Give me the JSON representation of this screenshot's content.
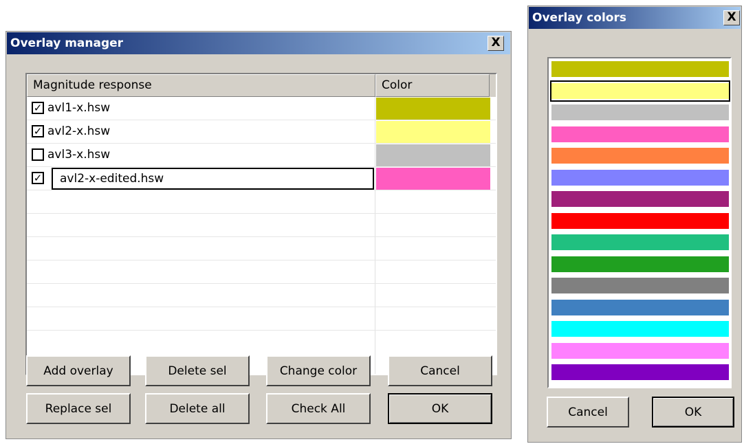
{
  "manager": {
    "title": "Overlay manager",
    "close_label": "X",
    "columns": {
      "name": "Magnitude response",
      "color": "Color"
    },
    "rows": [
      {
        "name": "avl1-x.hsw",
        "checked": true,
        "color": "#c0c000",
        "check_mark": "✓"
      },
      {
        "name": "avl2-x.hsw",
        "checked": true,
        "color": "#ffff80",
        "check_mark": "✓"
      },
      {
        "name": "avl3-x.hsw",
        "checked": false,
        "color": "#c0c0c0",
        "check_mark": ""
      },
      {
        "name": "avl2-x-edited.hsw",
        "checked": true,
        "color": "#ff5cc0",
        "check_mark": "✓",
        "editing": true
      }
    ],
    "buttons": {
      "add_overlay": "Add overlay",
      "delete_sel": "Delete sel",
      "change_color": "Change color",
      "cancel": "Cancel",
      "replace_sel": "Replace sel",
      "delete_all": "Delete all",
      "check_all": "Check All",
      "ok": "OK"
    }
  },
  "colors_dialog": {
    "title": "Overlay colors",
    "close_label": "X",
    "selected_index": 1,
    "palette": [
      "#c0c000",
      "#ffff80",
      "#c0c0c0",
      "#ff5cc0",
      "#ff8040",
      "#8080ff",
      "#a0207a",
      "#ff0000",
      "#20c080",
      "#20a020",
      "#808080",
      "#4080c0",
      "#00ffff",
      "#ff80ff",
      "#8000c0"
    ],
    "buttons": {
      "cancel": "Cancel",
      "ok": "OK"
    }
  }
}
